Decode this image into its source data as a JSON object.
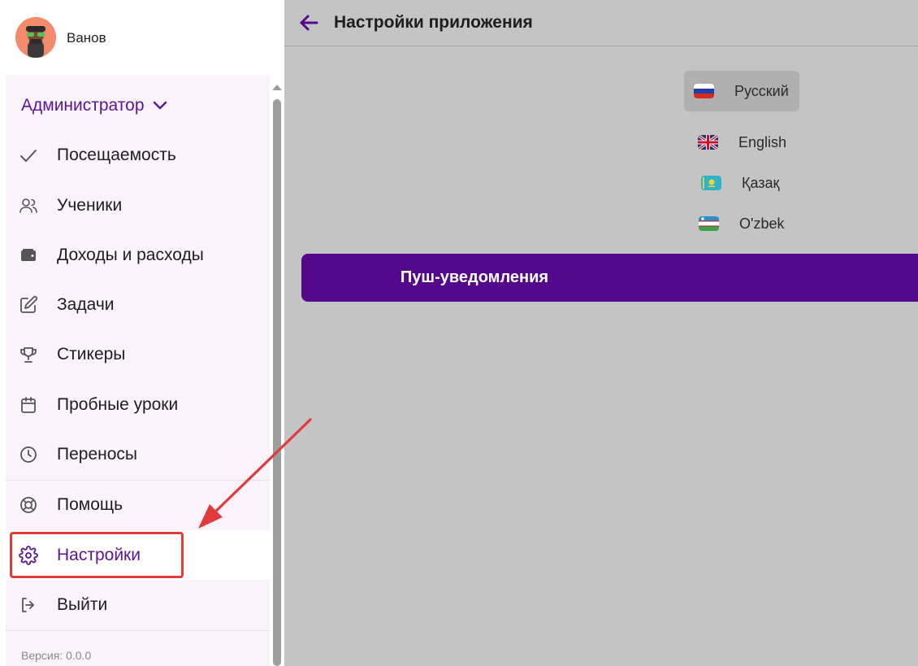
{
  "user": {
    "name": "Ванов"
  },
  "role": {
    "label": "Администратор"
  },
  "nav": {
    "items": [
      {
        "label": "Посещаемость",
        "icon": "check-icon"
      },
      {
        "label": "Ученики",
        "icon": "users-icon"
      },
      {
        "label": "Доходы и расходы",
        "icon": "wallet-icon"
      },
      {
        "label": "Задачи",
        "icon": "edit-icon"
      },
      {
        "label": "Стикеры",
        "icon": "trophy-icon"
      },
      {
        "label": "Пробные уроки",
        "icon": "calendar-icon"
      },
      {
        "label": "Переносы",
        "icon": "clock-icon"
      },
      {
        "label": "Помощь",
        "icon": "lifebuoy-icon"
      },
      {
        "label": "Настройки",
        "icon": "gear-icon",
        "active": true
      },
      {
        "label": "Выйти",
        "icon": "logout-icon"
      }
    ]
  },
  "version": "Версия: 0.0.0",
  "header": {
    "title": "Настройки приложения"
  },
  "languages": [
    {
      "label": "Русский",
      "selected": true
    },
    {
      "label": "English"
    },
    {
      "label": "Қазақ"
    },
    {
      "label": "O'zbek"
    }
  ],
  "push_button": {
    "label": "Пуш-уведомления"
  },
  "colors": {
    "accent": "#54098a",
    "active_text": "#5b1496",
    "highlight": "#e03a3a"
  }
}
